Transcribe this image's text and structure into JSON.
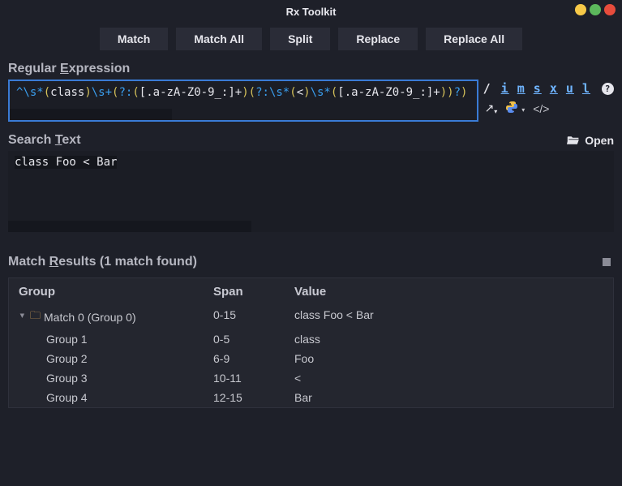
{
  "window": {
    "title": "Rx Toolkit"
  },
  "toolbar": {
    "match": "Match",
    "match_all": "Match All",
    "split": "Split",
    "replace": "Replace",
    "replace_all": "Replace All"
  },
  "regex_section": {
    "label_pre": "Regular ",
    "label_u": "E",
    "label_post": "xpression",
    "pattern_parts": {
      "p1": "^\\s*",
      "p2": "(",
      "p3": "class",
      "p4": ")",
      "p5": "\\s+",
      "p6": "(",
      "p7": "?:",
      "p8": "(",
      "p9": "[.a-zA-Z0-9_:]+",
      "p10": ")",
      "p11": "(",
      "p12": "?:",
      "p13": "\\s*",
      "p14": "(",
      "p15": "<",
      "p16": ")",
      "p17": "\\s*",
      "p18": "(",
      "p19": "[.a-zA-Z0-9_:]+",
      "p20": ")",
      "p21": ")",
      "p22": "?",
      "p23": ")"
    },
    "flags": {
      "slash": "/",
      "i": "i",
      "m": "m",
      "s": "s",
      "x": "x",
      "u": "u",
      "l": "l",
      "help": "?"
    }
  },
  "search_section": {
    "label_pre": "Search ",
    "label_u": "T",
    "label_post": "ext",
    "open": "Open",
    "text": "class Foo < Bar"
  },
  "results": {
    "label_pre": "Match ",
    "label_u": "R",
    "label_post": "esults (1 match found)",
    "headers": {
      "group": "Group",
      "span": "Span",
      "value": "Value"
    },
    "rows": [
      {
        "group": "Match 0 (Group 0)",
        "span": "0-15",
        "value": "class Foo < Bar",
        "kind": "match0"
      },
      {
        "group": "Group 1",
        "span": "0-5",
        "value": "class",
        "kind": "sub"
      },
      {
        "group": "Group 2",
        "span": "6-9",
        "value": "Foo",
        "kind": "sub"
      },
      {
        "group": "Group 3",
        "span": "10-11",
        "value": "<",
        "kind": "sub"
      },
      {
        "group": "Group 4",
        "span": "12-15",
        "value": "Bar",
        "kind": "sub"
      }
    ]
  }
}
